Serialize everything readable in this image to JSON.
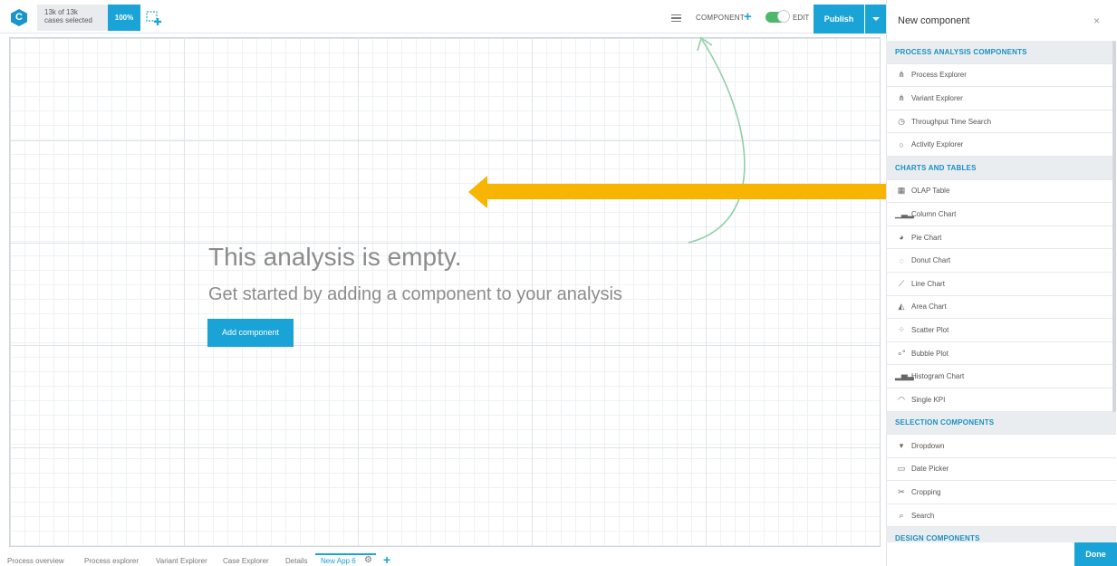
{
  "header": {
    "logo_letter": "C",
    "cases_line1": "13k of 13k",
    "cases_line2": "cases selected",
    "selection_pct": "100%",
    "component_label": "COMPONENT",
    "edit_label": "EDIT",
    "edit_toggle_on": true,
    "publish_label": "Publish"
  },
  "canvas": {
    "empty_title": "This analysis is empty.",
    "empty_subtitle": "Get started by adding a component to your analysis",
    "add_button_label": "Add component"
  },
  "tabs": [
    {
      "label": "Process overview"
    },
    {
      "label": "Process explorer"
    },
    {
      "label": "Variant Explorer"
    },
    {
      "label": "Case Explorer"
    },
    {
      "label": "Details"
    },
    {
      "label": "New App 6",
      "active": true
    }
  ],
  "panel": {
    "title": "New component",
    "close": "×",
    "done_label": "Done",
    "rows": [
      {
        "type": "section",
        "label": "PROCESS ANALYSIS COMPONENTS"
      },
      {
        "type": "item",
        "label": "Process Explorer",
        "icon": "hierarchy-icon",
        "glyph": "⋔"
      },
      {
        "type": "item",
        "label": "Variant Explorer",
        "icon": "hierarchy-icon",
        "glyph": "⋔"
      },
      {
        "type": "item",
        "label": "Throughput Time Search",
        "icon": "clock-icon",
        "glyph": "◷"
      },
      {
        "type": "item",
        "label": "Activity Explorer",
        "icon": "circle-icon",
        "glyph": "○"
      },
      {
        "type": "section",
        "label": "CHARTS AND TABLES"
      },
      {
        "type": "item",
        "label": "OLAP Table",
        "icon": "table-icon",
        "glyph": "▦"
      },
      {
        "type": "item",
        "label": "Column Chart",
        "icon": "column-chart-icon",
        "glyph": "▁▃▂"
      },
      {
        "type": "item",
        "label": "Pie Chart",
        "icon": "pie-chart-icon",
        "glyph": "◕"
      },
      {
        "type": "item",
        "label": "Donut Chart",
        "icon": "donut-chart-icon",
        "glyph": "◌"
      },
      {
        "type": "item",
        "label": "Line Chart",
        "icon": "line-chart-icon",
        "glyph": "⟋"
      },
      {
        "type": "item",
        "label": "Area Chart",
        "icon": "area-chart-icon",
        "glyph": "◭"
      },
      {
        "type": "item",
        "label": "Scatter Plot",
        "icon": "scatter-plot-icon",
        "glyph": "⁘"
      },
      {
        "type": "item",
        "label": "Bubble Plot",
        "icon": "bubble-plot-icon",
        "glyph": "∘°"
      },
      {
        "type": "item",
        "label": "Histogram Chart",
        "icon": "histogram-icon",
        "glyph": "▂▅▃"
      },
      {
        "type": "item",
        "label": "Single KPI",
        "icon": "gauge-icon",
        "glyph": "◠"
      },
      {
        "type": "section",
        "label": "SELECTION COMPONENTS"
      },
      {
        "type": "item",
        "label": "Dropdown",
        "icon": "dropdown-icon",
        "glyph": "▾"
      },
      {
        "type": "item",
        "label": "Date Picker",
        "icon": "calendar-icon",
        "glyph": "▭"
      },
      {
        "type": "item",
        "label": "Cropping",
        "icon": "scissors-icon",
        "glyph": "✂"
      },
      {
        "type": "item",
        "label": "Search",
        "icon": "search-icon",
        "glyph": "⌕"
      },
      {
        "type": "section",
        "label": "DESIGN COMPONENTS"
      }
    ]
  },
  "colors": {
    "accent": "#1aa3d6",
    "toggle_on": "#4cb86b",
    "annotation_arrow": "#f7b500",
    "annotation_curve": "#8fd0a6"
  }
}
